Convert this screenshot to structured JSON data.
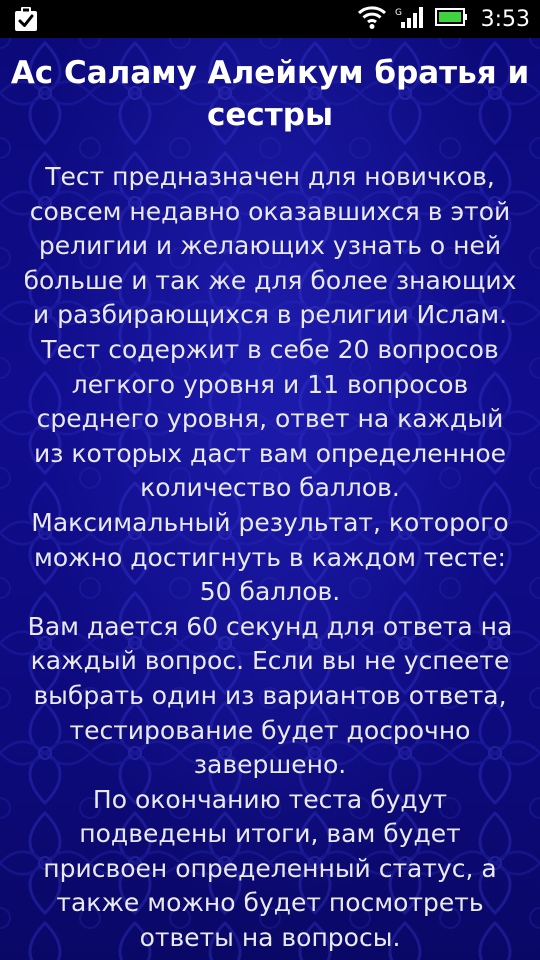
{
  "status_bar": {
    "time": "3:53",
    "icons": [
      "task-check-icon",
      "wifi-icon",
      "signal-icon",
      "battery-icon"
    ],
    "colors": {
      "battery": "#3fd23f",
      "background": "#000000"
    }
  },
  "screen": {
    "title": "Ас Саламу Алейкум братья и\nсестры",
    "paragraphs": [
      "Тест предназначен для новичков,\nсовсем недавно оказавшихся в этой\nрелигии и желающих узнать о ней\nбольше и так же для более знающих\nи разбирающихся в религии Ислам.",
      "Тест содержит в себе 20 вопросов\nлегкого уровня и 11 вопросов\nсреднего уровня, ответ на каждый\nиз которых даст вам определенное\nколичество баллов.",
      "Максимальный результат, которого\nможно достигнуть в каждом тесте:\n50 баллов.",
      "Вам дается 60 секунд для ответа на\nкаждый вопрос. Если вы не успеете\nвыбрать один из вариантов ответа,\nтестирование будет досрочно\nзавершено.",
      "По окончанию теста будут\nподведены итоги, вам будет\nприсвоен определенный статус, а\nтакже можно будет посмотреть\nответы на вопросы."
    ],
    "colors": {
      "background": "#0f0c8a",
      "text": "#ffffff"
    }
  }
}
